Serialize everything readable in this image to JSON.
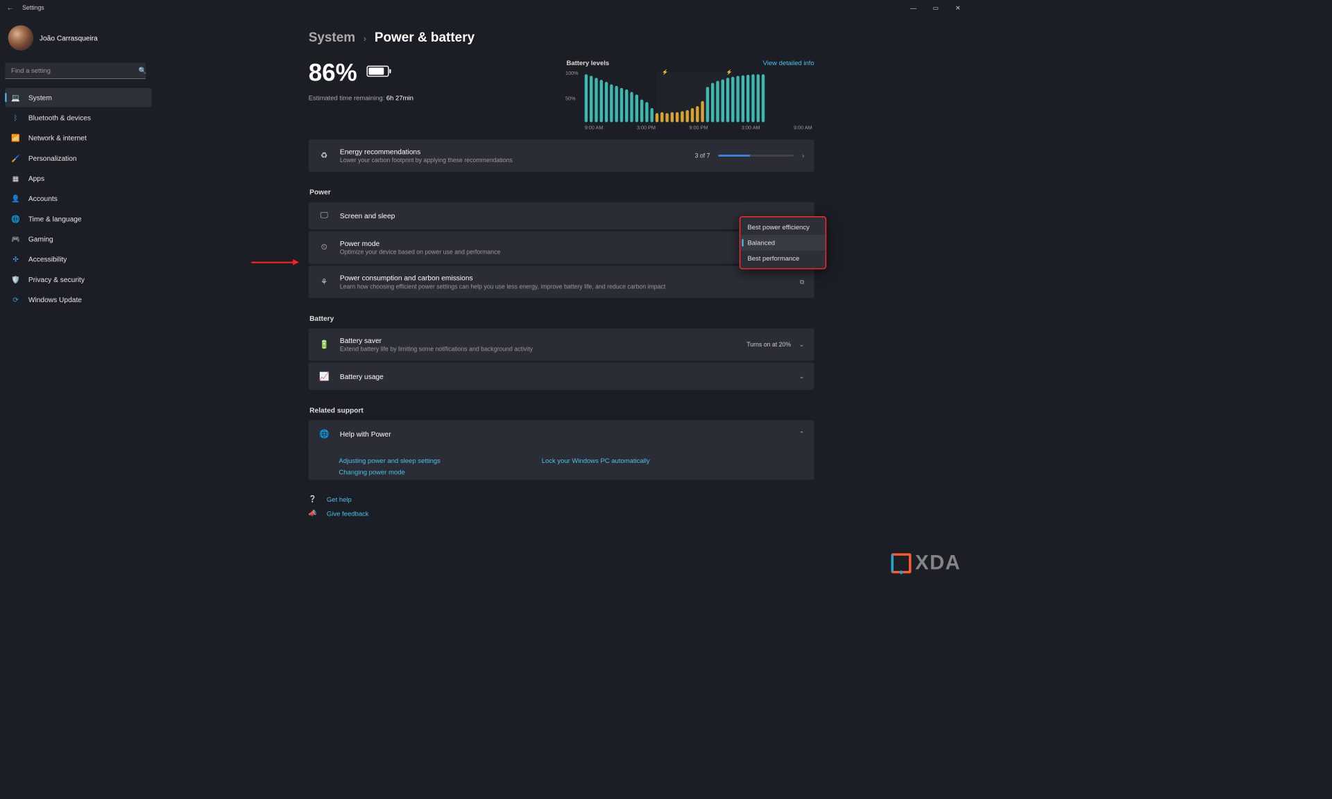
{
  "window": {
    "title": "Settings"
  },
  "user": {
    "name": "João Carrasqueira"
  },
  "search": {
    "placeholder": "Find a setting"
  },
  "nav": {
    "items": [
      {
        "label": "System",
        "selected": true
      },
      {
        "label": "Bluetooth & devices"
      },
      {
        "label": "Network & internet"
      },
      {
        "label": "Personalization"
      },
      {
        "label": "Apps"
      },
      {
        "label": "Accounts"
      },
      {
        "label": "Time & language"
      },
      {
        "label": "Gaming"
      },
      {
        "label": "Accessibility"
      },
      {
        "label": "Privacy & security"
      },
      {
        "label": "Windows Update"
      }
    ]
  },
  "breadcrumb": {
    "root": "System",
    "page": "Power & battery"
  },
  "battery": {
    "percent": "86%",
    "estimate_label": "Estimated time remaining:",
    "estimate_value": "6h 27min",
    "chart_title": "Battery levels",
    "detail_link": "View detailed info"
  },
  "chart_data": {
    "type": "bar",
    "title": "Battery levels",
    "ylabel": "%",
    "ylim": [
      0,
      100
    ],
    "y_ticks": [
      "100%",
      "50%"
    ],
    "x_ticks": [
      "9:00 AM",
      "3:00 PM",
      "9:00 PM",
      "3:00 AM",
      "9:00 AM"
    ],
    "series": [
      {
        "name": "battery",
        "values": [
          95,
          92,
          88,
          84,
          80,
          75,
          72,
          68,
          65,
          60,
          55,
          45,
          40,
          28,
          18,
          20,
          18,
          20,
          20,
          22,
          24,
          28,
          32,
          42,
          70,
          78,
          82,
          85,
          88,
          90,
          92,
          93,
          94,
          95,
          95,
          95
        ]
      },
      {
        "name": "color",
        "values": [
          "teal",
          "teal",
          "teal",
          "teal",
          "teal",
          "teal",
          "teal",
          "teal",
          "teal",
          "teal",
          "teal",
          "teal",
          "teal",
          "teal",
          "amber",
          "amber",
          "amber",
          "amber",
          "amber",
          "amber",
          "amber",
          "amber",
          "amber",
          "amber",
          "teal",
          "teal",
          "teal",
          "teal",
          "teal",
          "teal",
          "teal",
          "teal",
          "teal",
          "teal",
          "teal",
          "teal"
        ]
      }
    ],
    "markers": [
      {
        "type": "charge",
        "position_index": 14,
        "color": "amber"
      },
      {
        "type": "charge",
        "position_index": 24,
        "color": "teal"
      }
    ]
  },
  "cards": {
    "energy": {
      "title": "Energy recommendations",
      "sub": "Lower your carbon footprint by applying these recommendations",
      "progress": "3 of 7"
    },
    "screen": {
      "title": "Screen and sleep"
    },
    "mode": {
      "title": "Power mode",
      "sub": "Optimize your device based on power use and performance"
    },
    "carbon": {
      "title": "Power consumption and carbon emissions",
      "sub": "Learn how choosing efficient power settings can help you use less energy, improve battery life, and reduce carbon impact"
    },
    "saver": {
      "title": "Battery saver",
      "sub": "Extend battery life by limiting some notifications and background activity",
      "tail": "Turns on at 20%"
    },
    "usage": {
      "title": "Battery usage"
    },
    "help": {
      "title": "Help with Power"
    }
  },
  "sections": {
    "power": "Power",
    "battery": "Battery",
    "related": "Related support"
  },
  "dropdown": {
    "items": [
      "Best power efficiency",
      "Balanced",
      "Best performance"
    ],
    "selected": "Balanced"
  },
  "help_links": {
    "a": "Adjusting power and sleep settings",
    "b": "Lock your Windows PC automatically",
    "c": "Changing power mode"
  },
  "footer": {
    "help": "Get help",
    "feedback": "Give feedback"
  },
  "watermark": "XDA"
}
